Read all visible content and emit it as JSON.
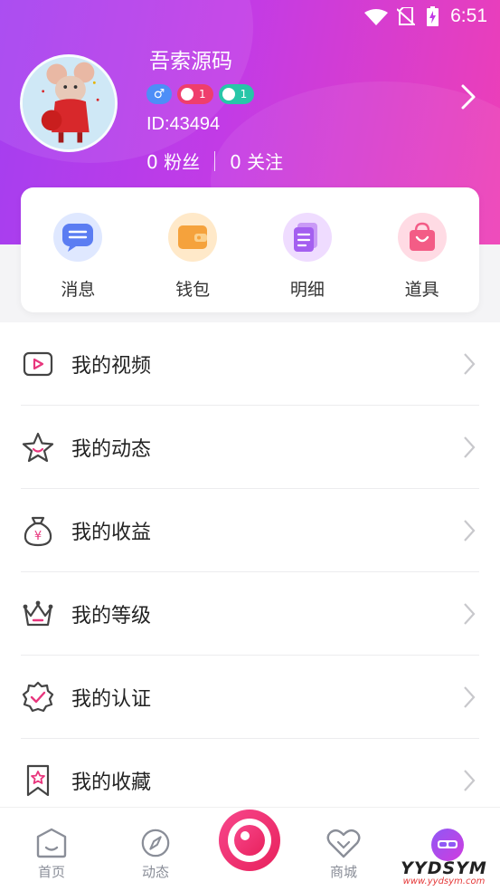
{
  "status_bar": {
    "time": "6:51"
  },
  "profile": {
    "username": "吾索源码",
    "gender_symbol": "♂",
    "voice_level": "1",
    "moon_level": "1",
    "user_id": "ID:43494",
    "fans": "0 粉丝",
    "following": "0 关注"
  },
  "quick_actions": [
    {
      "label": "消息",
      "icon": "message-icon"
    },
    {
      "label": "钱包",
      "icon": "wallet-icon"
    },
    {
      "label": "明细",
      "icon": "detail-icon"
    },
    {
      "label": "道具",
      "icon": "props-icon"
    }
  ],
  "menu": [
    {
      "label": "我的视频",
      "icon": "video-icon"
    },
    {
      "label": "我的动态",
      "icon": "star-icon"
    },
    {
      "label": "我的收益",
      "icon": "money-bag-icon"
    },
    {
      "label": "我的等级",
      "icon": "crown-icon"
    },
    {
      "label": "我的认证",
      "icon": "certified-icon"
    },
    {
      "label": "我的收藏",
      "icon": "bookmark-icon"
    }
  ],
  "tabbar": [
    {
      "label": "首页",
      "icon": "home-icon"
    },
    {
      "label": "动态",
      "icon": "compass-icon"
    },
    {
      "label": "",
      "icon": "record-icon"
    },
    {
      "label": "商城",
      "icon": "heart-icon"
    },
    {
      "label": "",
      "icon": "me-icon"
    }
  ],
  "watermark": {
    "line1": "YYDSYM",
    "line2": "www.yydsym.com"
  },
  "colors": {
    "accent_purple": "#b43deb",
    "accent_pink": "#ee3fb6",
    "record_pink": "#f0306e"
  }
}
